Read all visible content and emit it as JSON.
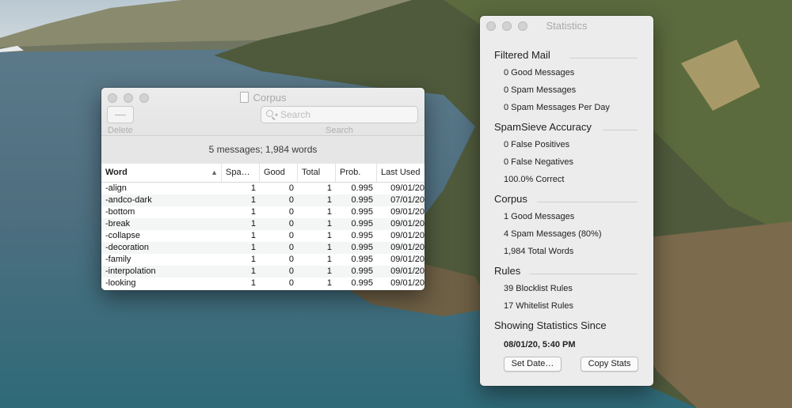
{
  "corpus_window": {
    "title": "Corpus",
    "toolbar": {
      "delete_button": "—",
      "delete_label": "Delete",
      "search_placeholder": "Search",
      "search_label": "Search"
    },
    "summary": "5 messages; 1,984 words",
    "columns": [
      "Word",
      "Spa…",
      "Good",
      "Total",
      "Prob.",
      "Last Used"
    ],
    "rows": [
      {
        "word": "-align",
        "spam": "1",
        "good": "0",
        "total": "1",
        "prob": "0.995",
        "last_used": "09/01/20"
      },
      {
        "word": "-andco-dark",
        "spam": "1",
        "good": "0",
        "total": "1",
        "prob": "0.995",
        "last_used": "07/01/20"
      },
      {
        "word": "-bottom",
        "spam": "1",
        "good": "0",
        "total": "1",
        "prob": "0.995",
        "last_used": "09/01/20"
      },
      {
        "word": "-break",
        "spam": "1",
        "good": "0",
        "total": "1",
        "prob": "0.995",
        "last_used": "09/01/20"
      },
      {
        "word": "-collapse",
        "spam": "1",
        "good": "0",
        "total": "1",
        "prob": "0.995",
        "last_used": "09/01/20"
      },
      {
        "word": "-decoration",
        "spam": "1",
        "good": "0",
        "total": "1",
        "prob": "0.995",
        "last_used": "09/01/20"
      },
      {
        "word": "-family",
        "spam": "1",
        "good": "0",
        "total": "1",
        "prob": "0.995",
        "last_used": "09/01/20"
      },
      {
        "word": "-interpolation",
        "spam": "1",
        "good": "0",
        "total": "1",
        "prob": "0.995",
        "last_used": "09/01/20"
      },
      {
        "word": "-looking",
        "spam": "1",
        "good": "0",
        "total": "1",
        "prob": "0.995",
        "last_used": "09/01/20"
      }
    ]
  },
  "stats_window": {
    "title": "Statistics",
    "filtered_mail": {
      "heading": "Filtered Mail",
      "good": "0 Good Messages",
      "spam": "0 Spam Messages",
      "per_day": "0 Spam Messages Per Day"
    },
    "accuracy": {
      "heading": "SpamSieve Accuracy",
      "false_positives": "0 False Positives",
      "false_negatives": "0 False Negatives",
      "correct": "100.0% Correct"
    },
    "corpus": {
      "heading": "Corpus",
      "good": "1 Good Messages",
      "spam": "4 Spam Messages (80%)",
      "words": "1,984 Total Words"
    },
    "rules": {
      "heading": "Rules",
      "blocklist": "39 Blocklist Rules",
      "whitelist": "17 Whitelist Rules"
    },
    "since": {
      "heading": "Showing Statistics Since",
      "date": "08/01/20, 5:40 PM"
    },
    "buttons": {
      "set_date": "Set Date…",
      "copy_stats": "Copy Stats"
    }
  }
}
